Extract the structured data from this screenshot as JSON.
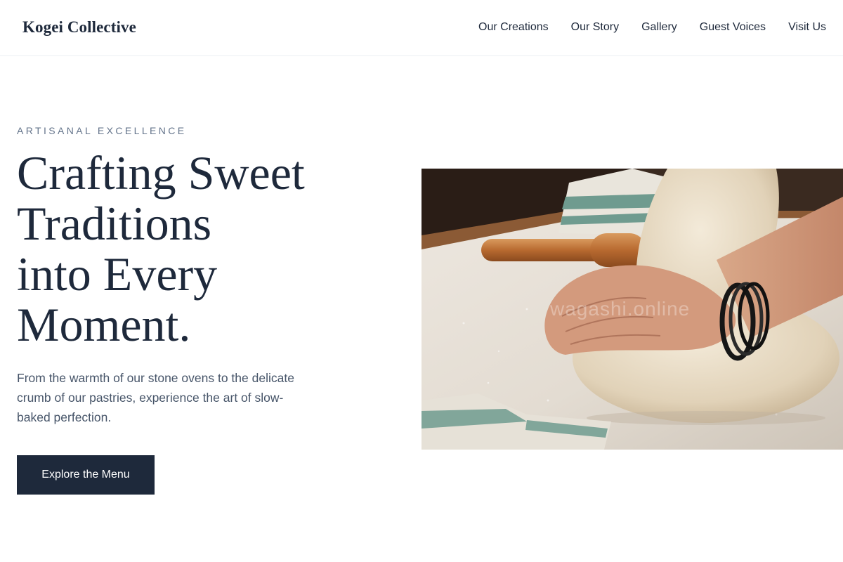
{
  "header": {
    "brand": "Kogei Collective",
    "nav": [
      "Our Creations",
      "Our Story",
      "Gallery",
      "Guest Voices",
      "Visit Us"
    ]
  },
  "hero": {
    "eyebrow": "ARTISANAL EXCELLENCE",
    "headline_lines": [
      "Crafting Sweet",
      "Traditions",
      "into Every",
      "Moment."
    ],
    "lead_lines": [
      "From the warmth of our stone ovens to the delicate",
      "crumb of our pastries, experience the art of slow-",
      "baked perfection."
    ],
    "cta_label": "Explore the Menu",
    "image_watermark": "wagashi.online"
  },
  "colors": {
    "navy": "#1e293b",
    "slate_text": "#475569",
    "eyebrow": "#64748b",
    "background": "#ffffff"
  }
}
